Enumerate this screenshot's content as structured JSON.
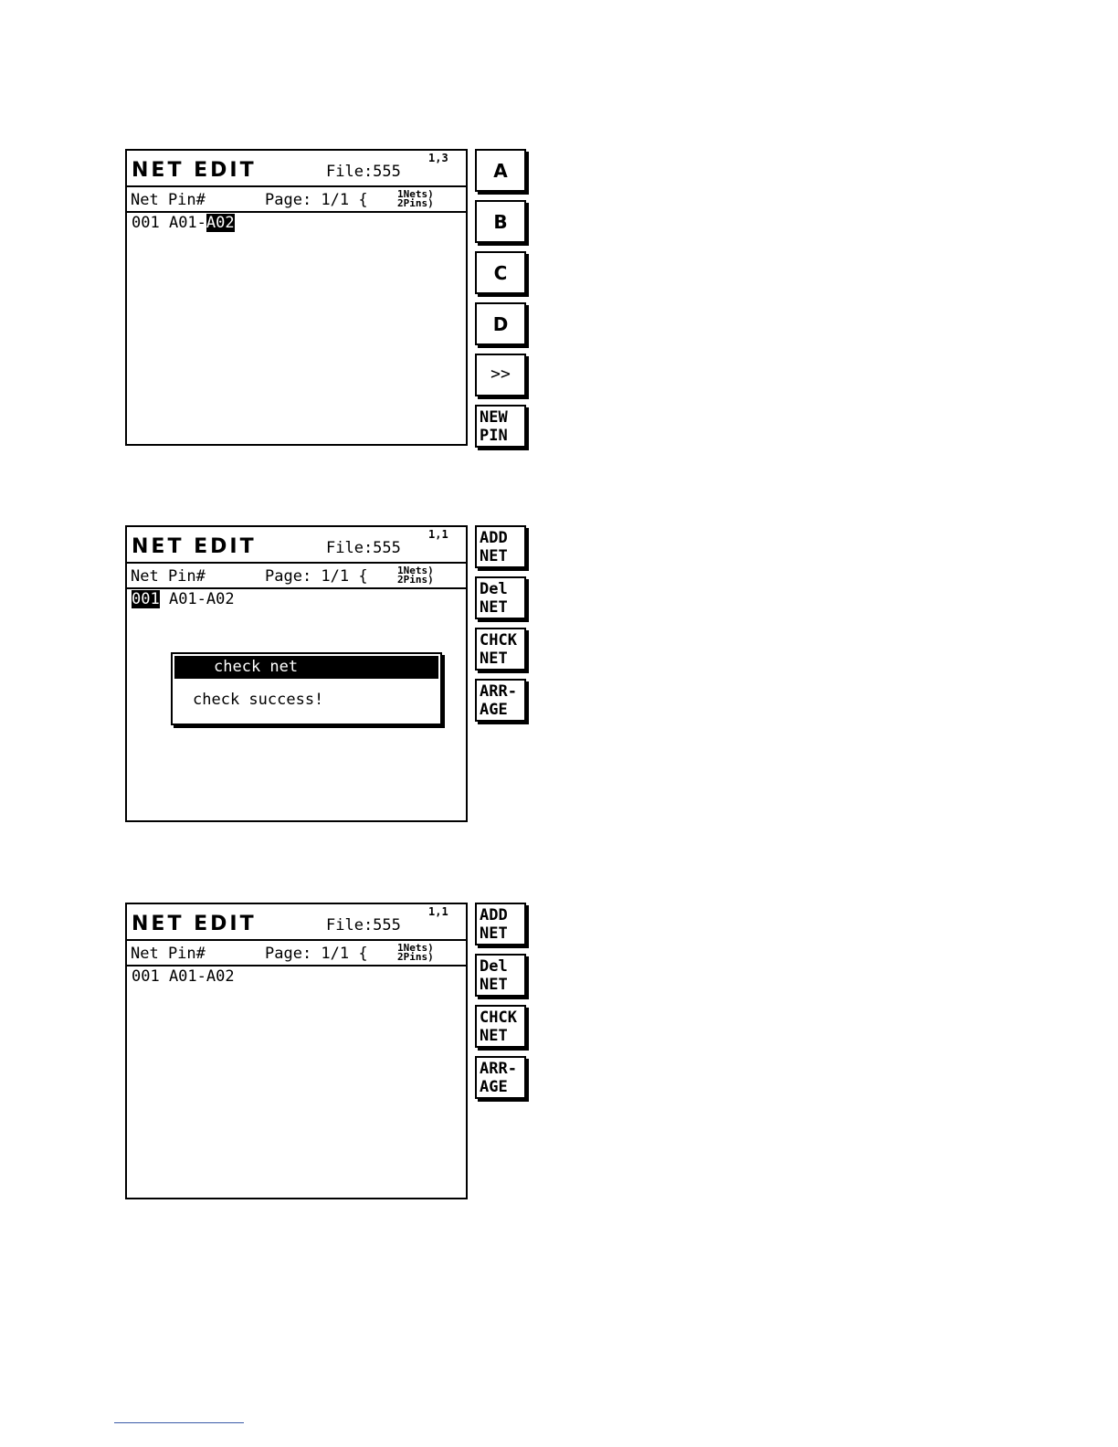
{
  "screens": [
    {
      "title": "NET  EDIT",
      "file": "File:555",
      "coord": "1,3",
      "cols": "Net Pin#",
      "page": "Page: 1/1 {",
      "nets": "1Nets)",
      "pins": "2Pins)",
      "row": {
        "net": "001",
        "pins_prefix": " A01-",
        "pin_last": "A02"
      },
      "buttons": [
        "A",
        "B",
        "C",
        "D",
        ">>"
      ],
      "new_pin": [
        "NEW",
        "PIN"
      ]
    },
    {
      "title": "NET  EDIT",
      "file": "File:555",
      "coord": "1,1",
      "cols": "Net Pin#",
      "page": "Page: 1/1 {",
      "nets": "1Nets)",
      "pins": "2Pins)",
      "row": {
        "net": "001",
        "pins": " A01-A02"
      },
      "dialog": {
        "title": "check net",
        "message": "check success!"
      },
      "buttons": [
        [
          "ADD",
          "NET"
        ],
        [
          "Del",
          "NET"
        ],
        [
          "CHCK",
          "NET"
        ],
        [
          "ARR-",
          "AGE"
        ]
      ]
    },
    {
      "title": "NET  EDIT",
      "file": "File:555",
      "coord": "1,1",
      "cols": "Net Pin#",
      "page": "Page: 1/1 {",
      "nets": "1Nets)",
      "pins": "2Pins)",
      "row": {
        "text": "001 A01-A02"
      },
      "buttons": [
        [
          "ADD",
          "NET"
        ],
        [
          "Del",
          "NET"
        ],
        [
          "CHCK",
          "NET"
        ],
        [
          "ARR-",
          "AGE"
        ]
      ]
    }
  ]
}
